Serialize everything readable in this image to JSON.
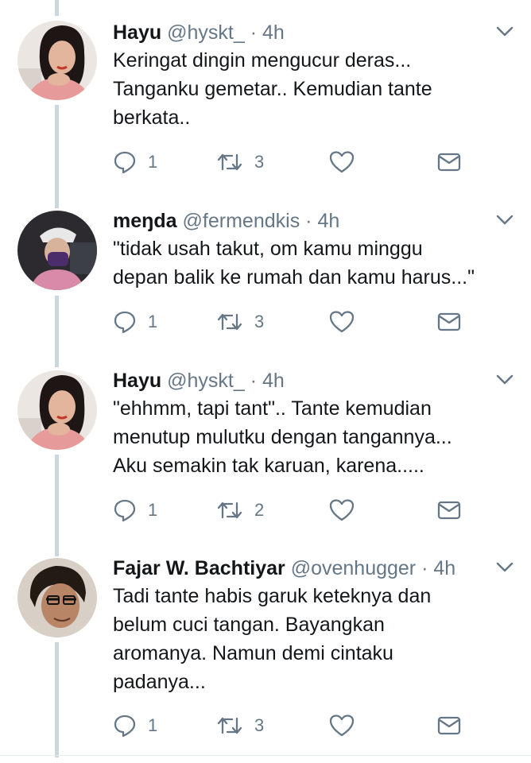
{
  "tweets": [
    {
      "name": "Hayu",
      "handle": "@hyskt_",
      "dot": "·",
      "time": "4h",
      "lines": [
        "Keringat dingin mengucur deras...",
        "Tanganku gemetar.. Kemudian tante",
        "berkata.."
      ],
      "reply_count": "1",
      "retweet_count": "3",
      "avatar": "hayu"
    },
    {
      "name": "meŋda",
      "handle": "@fermendkis",
      "dot": "·",
      "time": "4h",
      "lines": [
        "\"tidak usah takut, om kamu minggu",
        "depan balik ke rumah dan kamu harus...\""
      ],
      "reply_count": "1",
      "retweet_count": "3",
      "avatar": "menda"
    },
    {
      "name": "Hayu",
      "handle": "@hyskt_",
      "dot": "·",
      "time": "4h",
      "lines": [
        "\"ehhmm, tapi tant\".. Tante kemudian",
        "menutup mulutku dengan tangannya...",
        "Aku semakin tak karuan, karena....."
      ],
      "reply_count": "1",
      "retweet_count": "2",
      "avatar": "hayu"
    },
    {
      "name": "Fajar W. Bachtiyar",
      "handle": "@ovenhugger",
      "dot": "·",
      "time": "4h",
      "lines": [
        "Tadi tante habis garuk keteknya dan",
        "belum cuci tangan. Bayangkan",
        "aromanya. Namun demi cintaku",
        "padanya..."
      ],
      "reply_count": "1",
      "retweet_count": "3",
      "avatar": "fajar"
    }
  ],
  "colors": {
    "text": "#14171a",
    "secondary": "#657786",
    "thread_line": "#ccd6dd"
  },
  "icons": [
    "reply-icon",
    "retweet-icon",
    "like-icon",
    "direct-message-icon",
    "chevron-down-icon"
  ]
}
